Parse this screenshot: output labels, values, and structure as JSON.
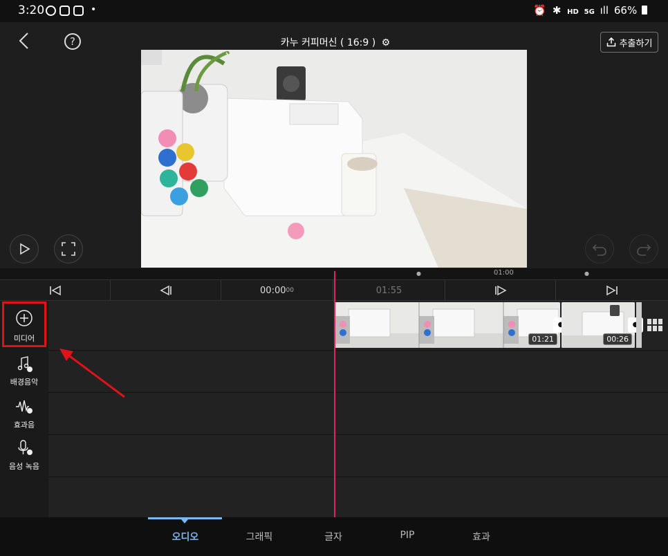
{
  "status_bar": {
    "time": "3:20",
    "battery": "66%",
    "network": "5G",
    "hd": "HD"
  },
  "top_bar": {
    "title": "카누 커피머신 ( 16:9 )",
    "export_label": "추출하기"
  },
  "timeline": {
    "ruler_label": "01:00",
    "current_time": "00:00",
    "current_frame": "00",
    "total_time": "01:55"
  },
  "sidebar": [
    {
      "label": "미디어",
      "icon": "plus-circle-icon"
    },
    {
      "label": "배경음악",
      "icon": "music-note-icon"
    },
    {
      "label": "효과음",
      "icon": "waveform-icon"
    },
    {
      "label": "음성 녹음",
      "icon": "microphone-icon"
    }
  ],
  "clips": [
    {
      "duration": "01:21"
    },
    {
      "duration": "00:26"
    }
  ],
  "bottom_tabs": [
    {
      "label": "오디오",
      "active": true
    },
    {
      "label": "그래픽",
      "active": false
    },
    {
      "label": "글자",
      "active": false
    },
    {
      "label": "PIP",
      "active": false
    },
    {
      "label": "효과",
      "active": false
    }
  ],
  "colors": {
    "accent": "#7db7f0",
    "playhead": "#e0245e",
    "highlight": "#e0121a"
  }
}
